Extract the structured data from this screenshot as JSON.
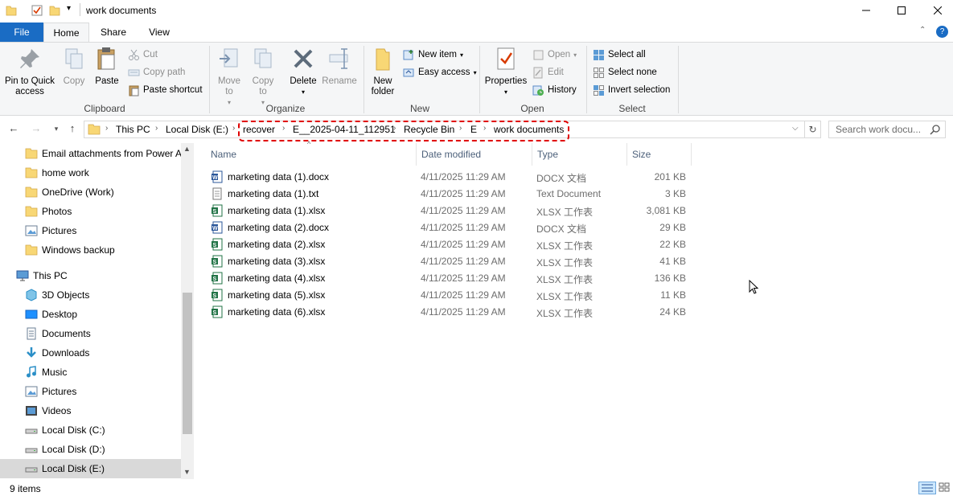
{
  "window": {
    "title": "work documents"
  },
  "tabs": [
    {
      "label": "File"
    },
    {
      "label": "Home"
    },
    {
      "label": "Share"
    },
    {
      "label": "View"
    }
  ],
  "ribbon": {
    "clipboard": {
      "label": "Clipboard",
      "pin": "Pin to Quick access",
      "copy": "Copy",
      "paste": "Paste",
      "cut": "Cut",
      "copy_path": "Copy path",
      "paste_shortcut": "Paste shortcut"
    },
    "organize": {
      "label": "Organize",
      "move_to": "Move to",
      "copy_to": "Copy to",
      "delete": "Delete",
      "rename": "Rename"
    },
    "new": {
      "label": "New",
      "new_folder": "New folder",
      "new_item": "New item",
      "easy_access": "Easy access"
    },
    "open": {
      "label": "Open",
      "properties": "Properties",
      "open": "Open",
      "edit": "Edit",
      "history": "History"
    },
    "select": {
      "label": "Select",
      "select_all": "Select all",
      "select_none": "Select none",
      "invert": "Invert selection"
    }
  },
  "address": {
    "crumbs": [
      "This PC",
      "Local Disk (E:)",
      "recover",
      "E__2025-04-11_112951",
      "Recycle Bin",
      "E",
      "work documents"
    ],
    "search_placeholder": "Search work docu..."
  },
  "nav": {
    "items": [
      {
        "label": "Email attachments from Power A",
        "icon": "folder-icon"
      },
      {
        "label": "home work",
        "icon": "folder-icon"
      },
      {
        "label": "OneDrive (Work)",
        "icon": "folder-icon"
      },
      {
        "label": "Photos",
        "icon": "folder-icon"
      },
      {
        "label": "Pictures",
        "icon": "pictures-icon"
      },
      {
        "label": "Windows backup",
        "icon": "folder-icon"
      },
      {
        "label": "This PC",
        "icon": "computer-icon"
      },
      {
        "label": "3D Objects",
        "icon": "3d-objects-icon"
      },
      {
        "label": "Desktop",
        "icon": "desktop-icon"
      },
      {
        "label": "Documents",
        "icon": "documents-icon"
      },
      {
        "label": "Downloads",
        "icon": "downloads-icon"
      },
      {
        "label": "Music",
        "icon": "music-icon"
      },
      {
        "label": "Pictures",
        "icon": "pictures-icon"
      },
      {
        "label": "Videos",
        "icon": "videos-icon"
      },
      {
        "label": "Local Disk (C:)",
        "icon": "drive-icon"
      },
      {
        "label": "Local Disk (D:)",
        "icon": "drive-icon"
      },
      {
        "label": "Local Disk (E:)",
        "icon": "drive-icon"
      }
    ]
  },
  "columns": {
    "name": "Name",
    "date": "Date modified",
    "type": "Type",
    "size": "Size"
  },
  "files": [
    {
      "name": "marketing data (1).docx",
      "date": "4/11/2025 11:29 AM",
      "type": "DOCX 文档",
      "size": "201 KB",
      "icon": "word-icon"
    },
    {
      "name": "marketing data (1).txt",
      "date": "4/11/2025 11:29 AM",
      "type": "Text Document",
      "size": "3 KB",
      "icon": "text-file-icon"
    },
    {
      "name": "marketing data (1).xlsx",
      "date": "4/11/2025 11:29 AM",
      "type": "XLSX 工作表",
      "size": "3,081 KB",
      "icon": "spreadsheet-icon"
    },
    {
      "name": "marketing data (2).docx",
      "date": "4/11/2025 11:29 AM",
      "type": "DOCX 文档",
      "size": "29 KB",
      "icon": "word-icon"
    },
    {
      "name": "marketing data (2).xlsx",
      "date": "4/11/2025 11:29 AM",
      "type": "XLSX 工作表",
      "size": "22 KB",
      "icon": "spreadsheet-icon"
    },
    {
      "name": "marketing data (3).xlsx",
      "date": "4/11/2025 11:29 AM",
      "type": "XLSX 工作表",
      "size": "41 KB",
      "icon": "spreadsheet-icon"
    },
    {
      "name": "marketing data (4).xlsx",
      "date": "4/11/2025 11:29 AM",
      "type": "XLSX 工作表",
      "size": "136 KB",
      "icon": "spreadsheet-icon"
    },
    {
      "name": "marketing data (5).xlsx",
      "date": "4/11/2025 11:29 AM",
      "type": "XLSX 工作表",
      "size": "11 KB",
      "icon": "spreadsheet-icon"
    },
    {
      "name": "marketing data (6).xlsx",
      "date": "4/11/2025 11:29 AM",
      "type": "XLSX 工作表",
      "size": "24 KB",
      "icon": "spreadsheet-icon"
    }
  ],
  "status": {
    "items_count": "9 items"
  },
  "colors": {
    "file_tab": "#1a6cc4",
    "highlight": "#e00000",
    "folder": "#f8d775",
    "word": "#2b579a",
    "excel": "#217346"
  }
}
